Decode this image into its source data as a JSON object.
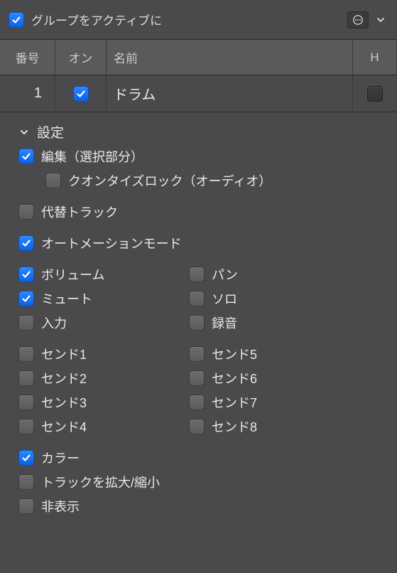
{
  "topbar": {
    "activate_group_label": "グループをアクティブに",
    "activate_group_checked": true
  },
  "table": {
    "headers": {
      "number": "番号",
      "on": "オン",
      "name": "名前",
      "h": "H"
    },
    "rows": [
      {
        "number": "1",
        "on": true,
        "name": "ドラム",
        "h": false
      }
    ]
  },
  "settings": {
    "section_label": "設定",
    "edit_selection": {
      "label": "編集（選択部分）",
      "checked": true
    },
    "quantize_lock": {
      "label": "クオンタイズロック（オーディオ）",
      "checked": false
    },
    "alt_track": {
      "label": "代替トラック",
      "checked": false
    },
    "automation_mode": {
      "label": "オートメーションモード",
      "checked": true
    },
    "volume": {
      "label": "ボリューム",
      "checked": true
    },
    "pan": {
      "label": "パン",
      "checked": false
    },
    "mute": {
      "label": "ミュート",
      "checked": true
    },
    "solo": {
      "label": "ソロ",
      "checked": false
    },
    "input": {
      "label": "入力",
      "checked": false
    },
    "record": {
      "label": "録音",
      "checked": false
    },
    "send1": {
      "label": "センド1",
      "checked": false
    },
    "send2": {
      "label": "センド2",
      "checked": false
    },
    "send3": {
      "label": "センド3",
      "checked": false
    },
    "send4": {
      "label": "センド4",
      "checked": false
    },
    "send5": {
      "label": "センド5",
      "checked": false
    },
    "send6": {
      "label": "センド6",
      "checked": false
    },
    "send7": {
      "label": "センド7",
      "checked": false
    },
    "send8": {
      "label": "センド8",
      "checked": false
    },
    "color": {
      "label": "カラー",
      "checked": true
    },
    "track_zoom": {
      "label": "トラックを拡大/縮小",
      "checked": false
    },
    "hide": {
      "label": "非表示",
      "checked": false
    }
  }
}
